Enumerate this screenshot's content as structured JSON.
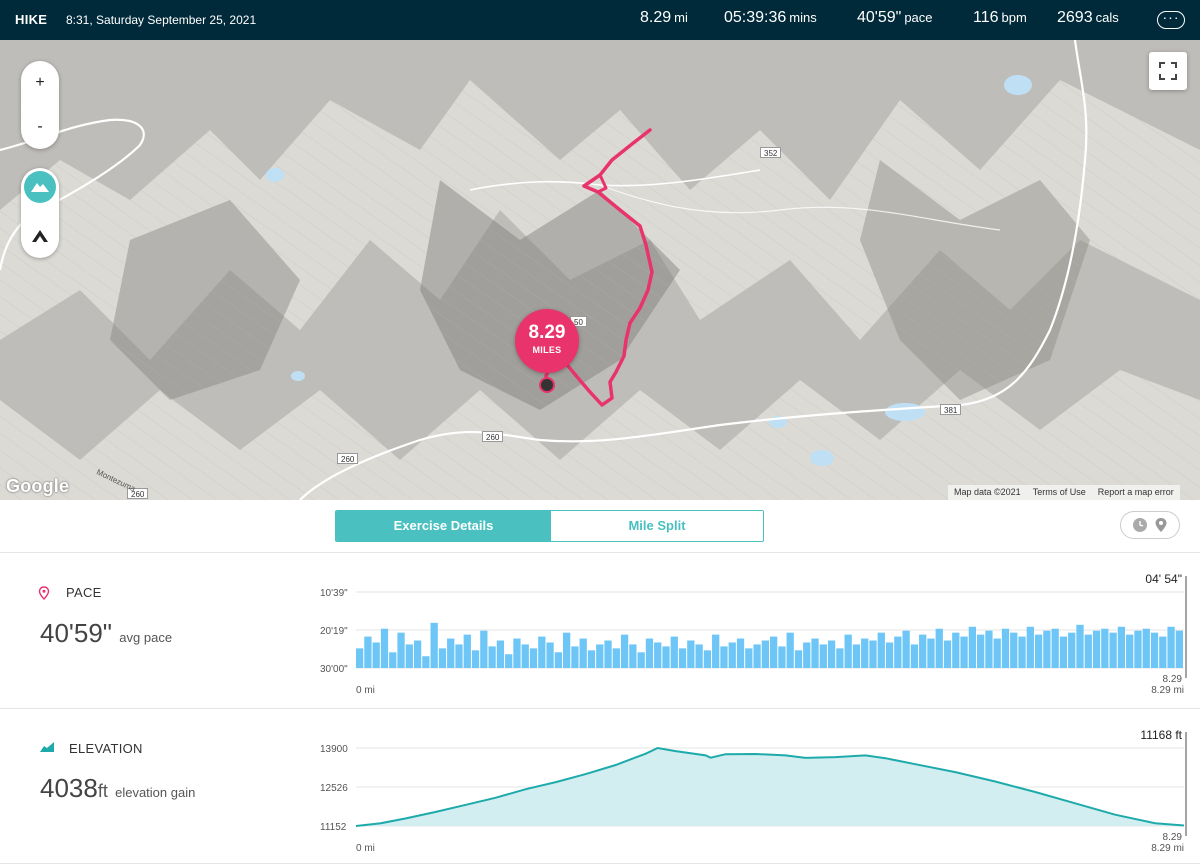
{
  "header": {
    "activity": "HIKE",
    "datetime": "8:31, Saturday September 25, 2021",
    "stats": [
      {
        "value": "8.29",
        "unit": "mi"
      },
      {
        "value": "05:39:36",
        "unit": "mins"
      },
      {
        "value": "40'59\"",
        "unit": "pace"
      },
      {
        "value": "116",
        "unit": "bpm"
      },
      {
        "value": "2693",
        "unit": "cals"
      }
    ],
    "more_label": "···"
  },
  "map": {
    "zoom_in": "+",
    "zoom_out": "-",
    "marker_value": "8.29",
    "marker_unit": "MILES",
    "logo": "Google",
    "attribution": [
      "Map data ©2021",
      "Terms of Use",
      "Report a map error"
    ],
    "road_shields": [
      "352",
      "260",
      "260",
      "260",
      "381",
      "50"
    ],
    "place_label": "Montezuma",
    "route_color": "#e8336c",
    "icons": [
      "terrain-icon",
      "hiker-icon",
      "fullscreen-icon"
    ]
  },
  "tabs": [
    {
      "label": "Exercise Details",
      "active": true
    },
    {
      "label": "Mile Split",
      "active": false
    }
  ],
  "view_toggle": {
    "icons": [
      "clock-icon",
      "location-pin-icon"
    ]
  },
  "pace": {
    "title": "PACE",
    "value": "40'59\"",
    "suffix": "avg pace",
    "color": "#6ec6f7"
  },
  "elevation": {
    "title": "ELEVATION",
    "value": "4038",
    "unit": "ft",
    "suffix": "elevation gain",
    "color": "#1eaaaa",
    "fill": "#d2eef0"
  },
  "chart_data": [
    {
      "type": "bar",
      "title": "PACE",
      "y_tick_labels": [
        "10'39\"",
        "20'19\"",
        "30'00\""
      ],
      "x_start_label": "0 mi",
      "x_end_label": "8.29 mi",
      "marker_x_label": "8.29",
      "marker_value_label": "04' 54\"",
      "x_range_miles": [
        0,
        8.29
      ],
      "y_range_seconds_per_mile": [
        1800,
        639
      ],
      "y_axis_inverted": true,
      "series_pace_seconds_per_mile": [
        1500,
        1320,
        1410,
        1200,
        1560,
        1260,
        1440,
        1380,
        1620,
        1110,
        1500,
        1350,
        1440,
        1290,
        1530,
        1230,
        1470,
        1380,
        1590,
        1350,
        1440,
        1500,
        1320,
        1410,
        1560,
        1260,
        1470,
        1350,
        1530,
        1440,
        1380,
        1500,
        1290,
        1440,
        1560,
        1350,
        1410,
        1470,
        1320,
        1500,
        1380,
        1440,
        1530,
        1290,
        1470,
        1410,
        1350,
        1500,
        1440,
        1380,
        1320,
        1470,
        1260,
        1530,
        1410,
        1350,
        1440,
        1380,
        1500,
        1290,
        1440,
        1350,
        1380,
        1260,
        1410,
        1320,
        1230,
        1440,
        1290,
        1350,
        1200,
        1380,
        1260,
        1320,
        1170,
        1290,
        1230,
        1350,
        1200,
        1260,
        1320,
        1170,
        1290,
        1230,
        1200,
        1320,
        1260,
        1140,
        1290,
        1230,
        1200,
        1260,
        1170,
        1290,
        1230,
        1200,
        1260,
        1320,
        1170,
        1230
      ]
    },
    {
      "type": "area",
      "title": "ELEVATION",
      "y_tick_labels": [
        "13900",
        "12526",
        "11152"
      ],
      "x_start_label": "0 mi",
      "x_end_label": "8.29 mi",
      "marker_x_label": "8.29",
      "marker_value_label": "11168 ft",
      "x_range_miles": [
        0,
        8.29
      ],
      "y_range_ft": [
        11152,
        13900
      ],
      "x_miles": [
        0,
        0.25,
        0.5,
        0.8,
        1.1,
        1.4,
        1.7,
        2.0,
        2.3,
        2.6,
        2.9,
        3.02,
        3.2,
        3.5,
        3.55,
        3.7,
        4.0,
        4.3,
        4.5,
        4.8,
        5.1,
        5.3,
        5.6,
        6.0,
        6.4,
        6.8,
        7.2,
        7.6,
        8.0,
        8.29
      ],
      "elevation_ft": [
        11152,
        11250,
        11420,
        11650,
        11900,
        12150,
        12450,
        12700,
        12980,
        13300,
        13700,
        13900,
        13790,
        13640,
        13560,
        13680,
        13690,
        13640,
        13550,
        13580,
        13640,
        13540,
        13330,
        13050,
        12720,
        12350,
        11950,
        11550,
        11250,
        11168
      ]
    }
  ]
}
